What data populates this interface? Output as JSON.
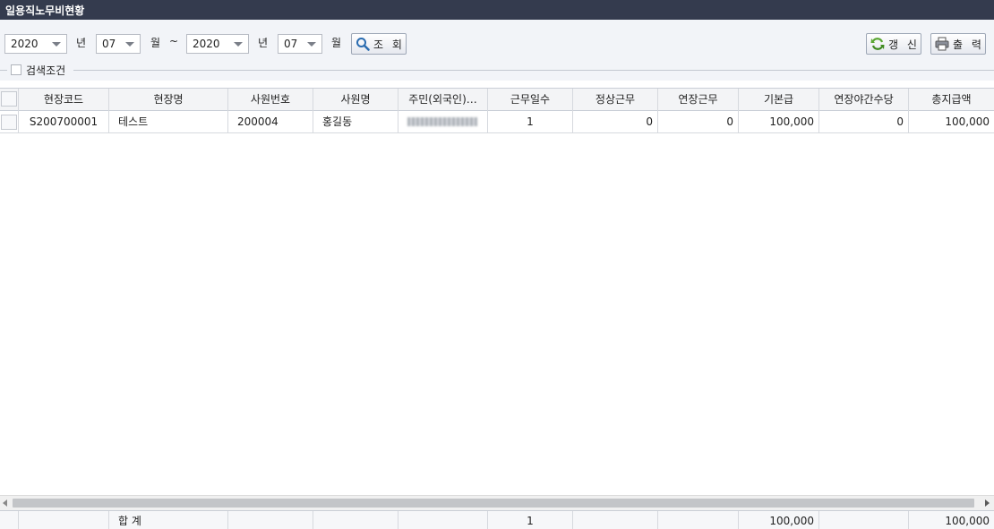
{
  "window": {
    "title": "일용직노무비현황"
  },
  "filters": {
    "from_year": "2020",
    "from_month": "07",
    "year_unit": "년",
    "month_unit": "월",
    "tilde": "~",
    "to_year": "2020",
    "to_month": "07",
    "search_label": "조 회",
    "refresh_label": "갱 신",
    "print_label": "출 력",
    "conditions_label": "검색조건"
  },
  "table": {
    "columns": [
      "현장코드",
      "현장명",
      "사원번호",
      "사원명",
      "주민(외국인)…",
      "근무일수",
      "정상근무",
      "연장근무",
      "기본급",
      "연장야간수당",
      "총지급액"
    ],
    "rows": [
      {
        "site_code": "S200700001",
        "site_name": "테스트",
        "emp_no": "200004",
        "emp_name": "홍길동",
        "resident_no": "",
        "work_days": "1",
        "normal_work": "0",
        "overtime_work": "0",
        "base_pay": "100,000",
        "night_allowance": "0",
        "total_pay": "100,000"
      }
    ],
    "footer": {
      "label": "합 계",
      "work_days": "1",
      "base_pay": "100,000",
      "total_pay": "100,000"
    }
  },
  "colors": {
    "titlebar": "#343b4e",
    "toolbar_bg": "#f2f4f8",
    "refresh_icon": "#5aa632",
    "search_icon": "#2b6cb0"
  },
  "icons": {
    "search": "magnifier-icon",
    "refresh": "refresh-icon",
    "print": "printer-icon"
  }
}
